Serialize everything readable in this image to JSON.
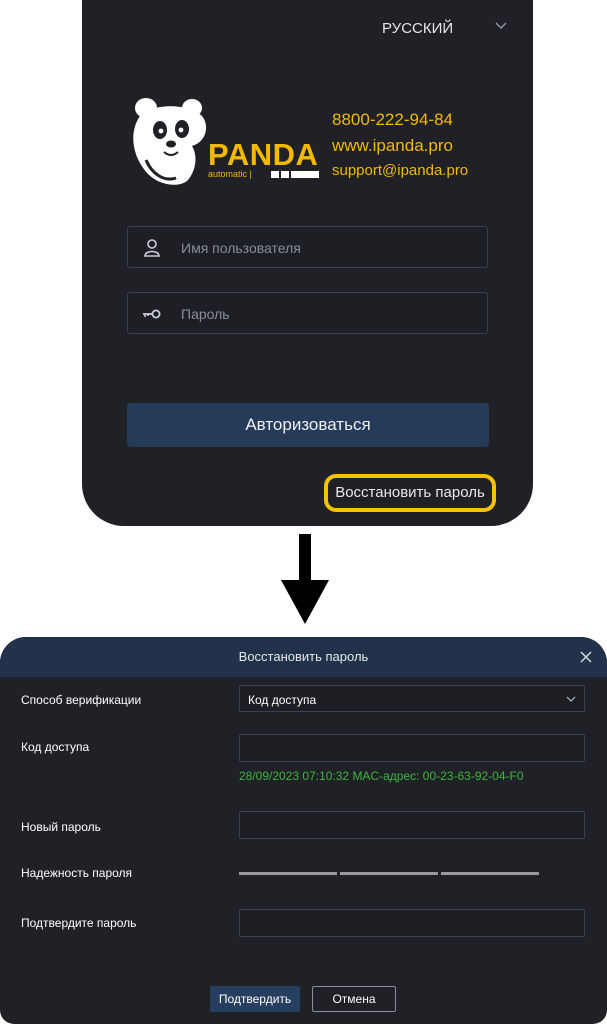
{
  "login": {
    "language": "РУССКИЙ",
    "brand_name": "PANDA",
    "brand_tagline": "automatic |",
    "contacts": {
      "phone": "8800-222-94-84",
      "website": "www.ipanda.pro",
      "email": "support@ipanda.pro"
    },
    "username_placeholder": "Имя пользователя",
    "password_placeholder": "Пароль",
    "login_button": "Авторизоваться",
    "restore_link": "Восстановить пароль"
  },
  "dialog": {
    "title": "Восстановить пароль",
    "fields": {
      "verification_method_label": "Способ верификации",
      "verification_method_value": "Код доступа",
      "access_code_label": "Код доступа",
      "access_code_value": "",
      "mac_info": "28/09/2023 07:10:32 MAC-адрес: 00-23-63-92-04-F0",
      "new_password_label": "Новый пароль",
      "new_password_value": "",
      "strength_label": "Надежность пароля",
      "confirm_password_label": "Подтвердите пароль",
      "confirm_password_value": ""
    },
    "confirm_button": "Подтвердить",
    "cancel_button": "Отмена"
  },
  "colors": {
    "accent_yellow": "#f3b800",
    "panel_bg": "#1f2126",
    "button_blue": "#253b59",
    "mac_green": "#3db53d"
  }
}
